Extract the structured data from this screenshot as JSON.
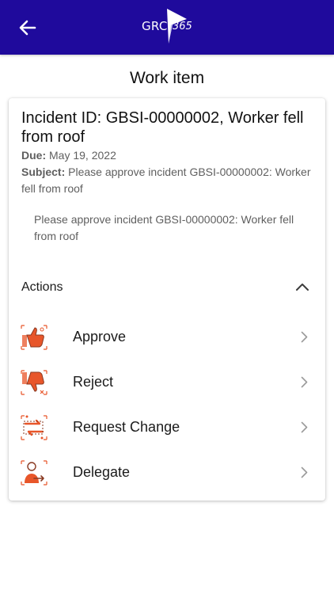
{
  "header": {
    "logo_text": "GRC",
    "logo_number": "365",
    "bar_color": "#1f0a9c",
    "back_icon": "arrow-left-icon"
  },
  "page": {
    "title": "Work item"
  },
  "incident": {
    "title": "Incident ID: GBSI-00000002, Worker fell from roof",
    "due_label": "Due:",
    "due_value": "May 19, 2022",
    "subject_label": "Subject:",
    "subject_value": "Please approve incident GBSI-00000002: Worker fell from roof",
    "message": "Please approve incident GBSI-00000002: Worker fell from roof"
  },
  "actions": {
    "label": "Actions",
    "accent_color": "#e8562a",
    "items": [
      {
        "label": "Approve",
        "icon": "thumbs-up-icon"
      },
      {
        "label": "Reject",
        "icon": "thumbs-down-icon"
      },
      {
        "label": "Request Change",
        "icon": "swap-arrows-icon"
      },
      {
        "label": "Delegate",
        "icon": "delegate-person-icon"
      }
    ]
  }
}
